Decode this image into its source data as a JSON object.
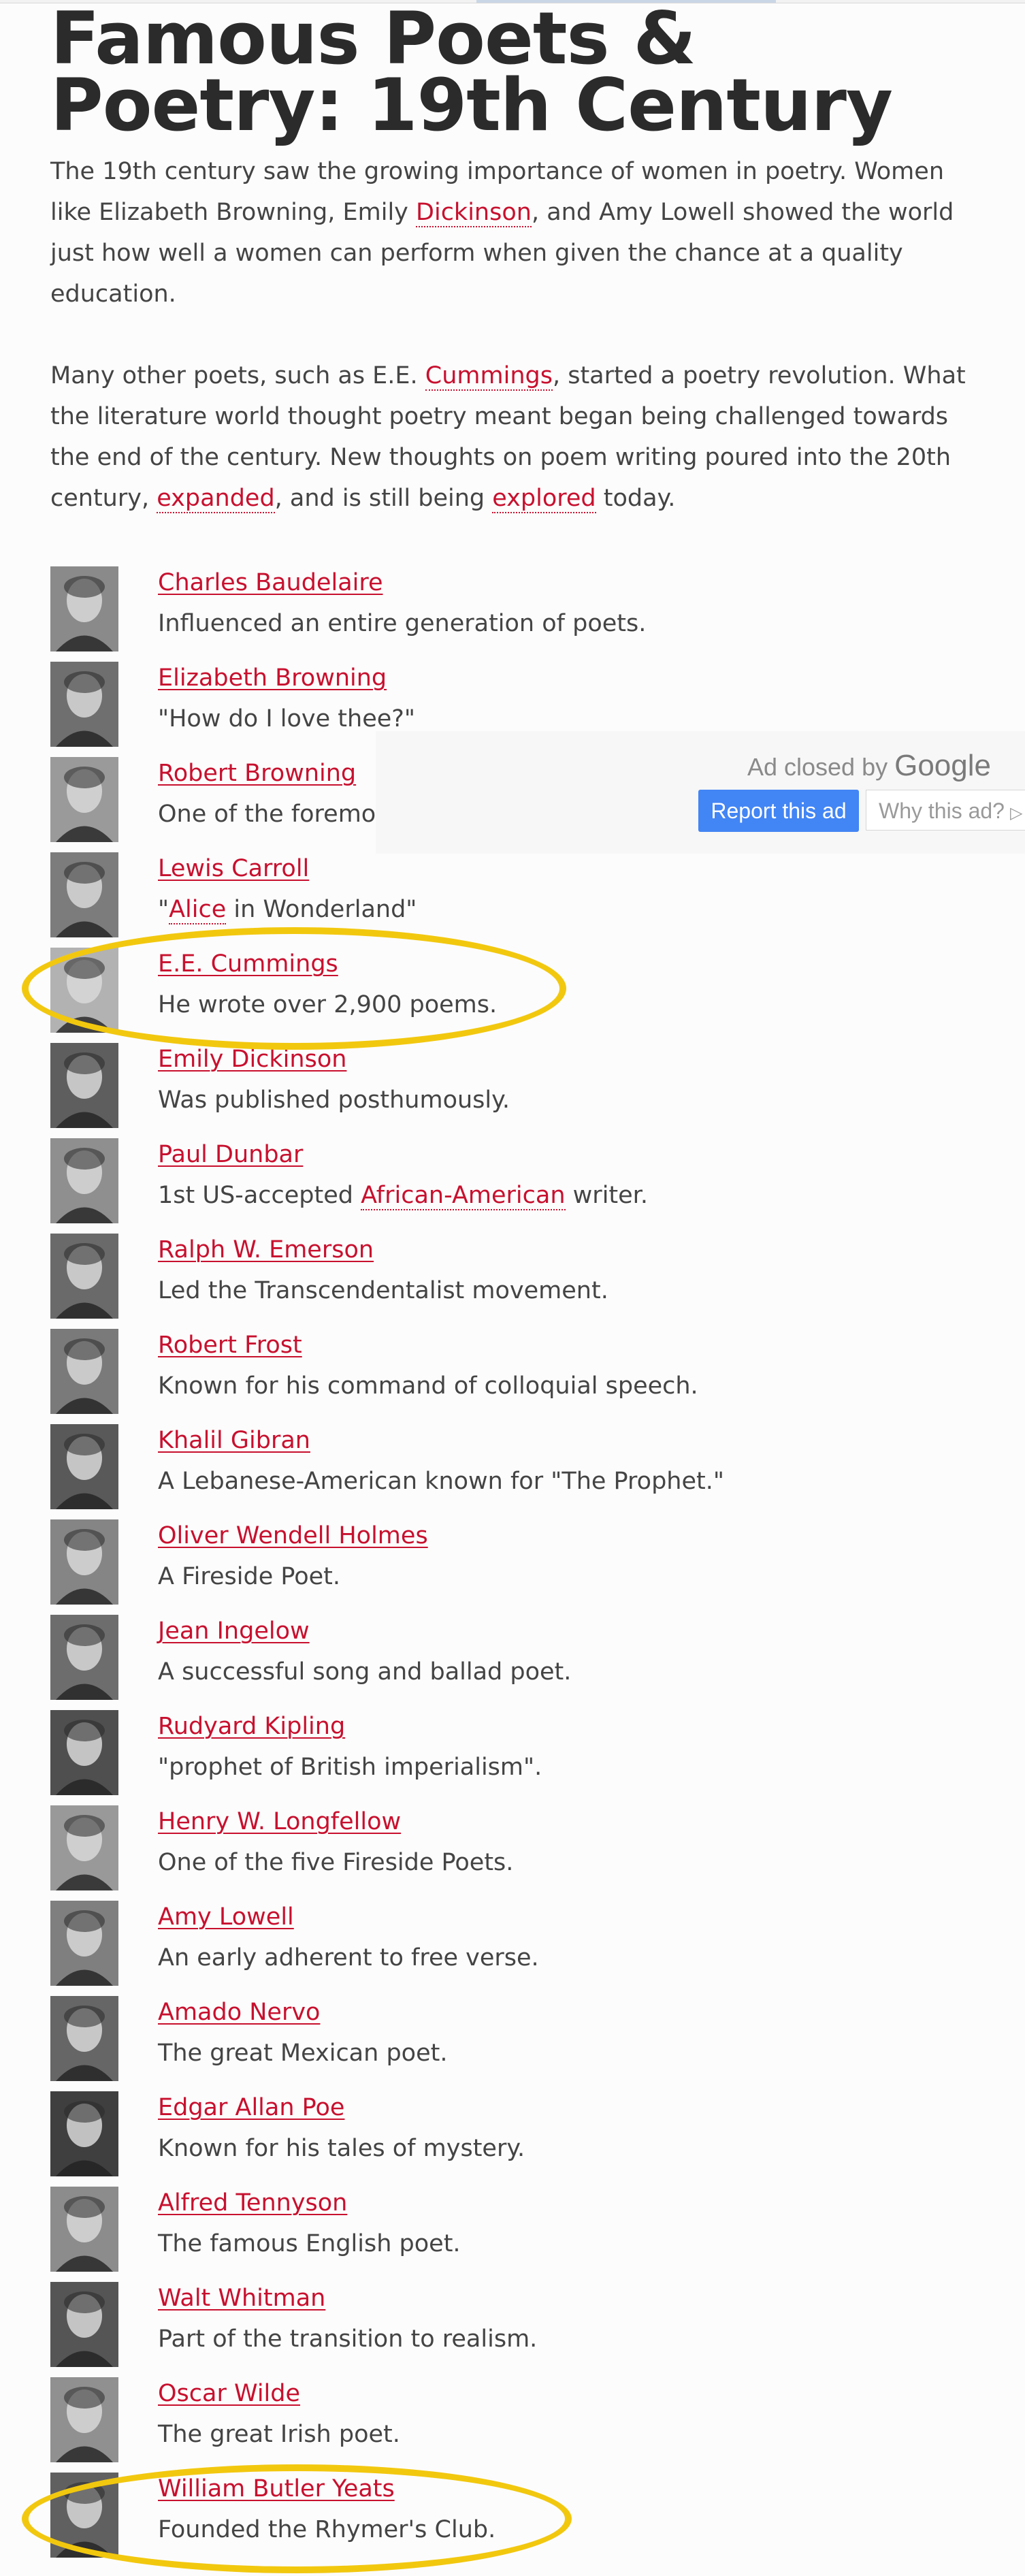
{
  "page": {
    "title": "Famous Poets & Poetry: 19th Century"
  },
  "intro": {
    "p1": [
      {
        "text": "The 19th century saw the growing importance of women in poetry. Women like Elizabeth Browning, Emily "
      },
      {
        "text": "Dickinson",
        "link": true
      },
      {
        "text": ", and Amy Lowell showed the world just how well a women can perform when given the chance at a quality education."
      }
    ],
    "p2": [
      {
        "text": "Many other poets, such as E.E. "
      },
      {
        "text": "Cummings",
        "link": true
      },
      {
        "text": ", started a poetry revolution. What the literature world thought poetry meant began being challenged towards the end of the century. New thoughts on poem writing poured into the 20th century, "
      },
      {
        "text": "expanded",
        "link": true
      },
      {
        "text": ", and is still being "
      },
      {
        "text": "explored",
        "link": true
      },
      {
        "text": " today."
      }
    ]
  },
  "poets": [
    {
      "name": "Charles Baudelaire",
      "desc": [
        {
          "text": "Influenced an entire generation of poets."
        }
      ]
    },
    {
      "name": "Elizabeth Browning",
      "desc": [
        {
          "text": "\"How do I love thee?\""
        }
      ]
    },
    {
      "name": "Robert Browning",
      "desc": [
        {
          "text": "One of the foremo"
        }
      ]
    },
    {
      "name": "Lewis Carroll",
      "desc": [
        {
          "text": "\""
        },
        {
          "text": "Alice",
          "link": true
        },
        {
          "text": " in Wonderland\""
        }
      ]
    },
    {
      "name": "E.E. Cummings",
      "desc": [
        {
          "text": "He wrote over 2,900 poems."
        }
      ]
    },
    {
      "name": "Emily Dickinson",
      "desc": [
        {
          "text": "Was published posthumously."
        }
      ]
    },
    {
      "name": "Paul Dunbar",
      "desc": [
        {
          "text": "1st US-accepted "
        },
        {
          "text": "African-American",
          "link": true
        },
        {
          "text": " writer."
        }
      ]
    },
    {
      "name": "Ralph W. Emerson",
      "desc": [
        {
          "text": "Led the Transcendentalist movement."
        }
      ]
    },
    {
      "name": "Robert Frost",
      "desc": [
        {
          "text": "Known for his command of colloquial speech."
        }
      ]
    },
    {
      "name": "Khalil Gibran",
      "desc": [
        {
          "text": "A Lebanese-American known for \"The Prophet.\""
        }
      ]
    },
    {
      "name": "Oliver Wendell Holmes",
      "desc": [
        {
          "text": "A Fireside Poet."
        }
      ]
    },
    {
      "name": "Jean Ingelow",
      "desc": [
        {
          "text": "A successful song and ballad poet."
        }
      ]
    },
    {
      "name": "Rudyard Kipling",
      "desc": [
        {
          "text": "\"prophet of British imperialism\"."
        }
      ]
    },
    {
      "name": "Henry W. Longfellow",
      "desc": [
        {
          "text": "One of the five Fireside Poets."
        }
      ]
    },
    {
      "name": "Amy Lowell",
      "desc": [
        {
          "text": "An early adherent to free verse."
        }
      ]
    },
    {
      "name": "Amado Nervo",
      "desc": [
        {
          "text": "The great Mexican poet."
        }
      ]
    },
    {
      "name": "Edgar Allan Poe",
      "desc": [
        {
          "text": "Known for his tales of mystery."
        }
      ]
    },
    {
      "name": "Alfred Tennyson",
      "desc": [
        {
          "text": "The famous English poet."
        }
      ]
    },
    {
      "name": "Walt Whitman",
      "desc": [
        {
          "text": "Part of the transition to realism."
        }
      ]
    },
    {
      "name": "Oscar Wilde",
      "desc": [
        {
          "text": "The great Irish poet."
        }
      ]
    },
    {
      "name": "William Butler Yeats",
      "desc": [
        {
          "text": "Founded the Rhymer's Club."
        }
      ]
    }
  ],
  "ad": {
    "closed_prefix": "Ad closed by ",
    "closed_brand": "Google",
    "report_label": "Report this ad",
    "why_label": "Why this ad?",
    "why_icon": "play-triangle-icon"
  },
  "highlights": {
    "color": "#f2c80f",
    "items": [
      "E.E. Cummings",
      "William Butler Yeats"
    ]
  },
  "colors": {
    "link": "#c8102e",
    "text": "#444444",
    "heading": "#2b2b2b",
    "ad_button": "#4285f4"
  }
}
